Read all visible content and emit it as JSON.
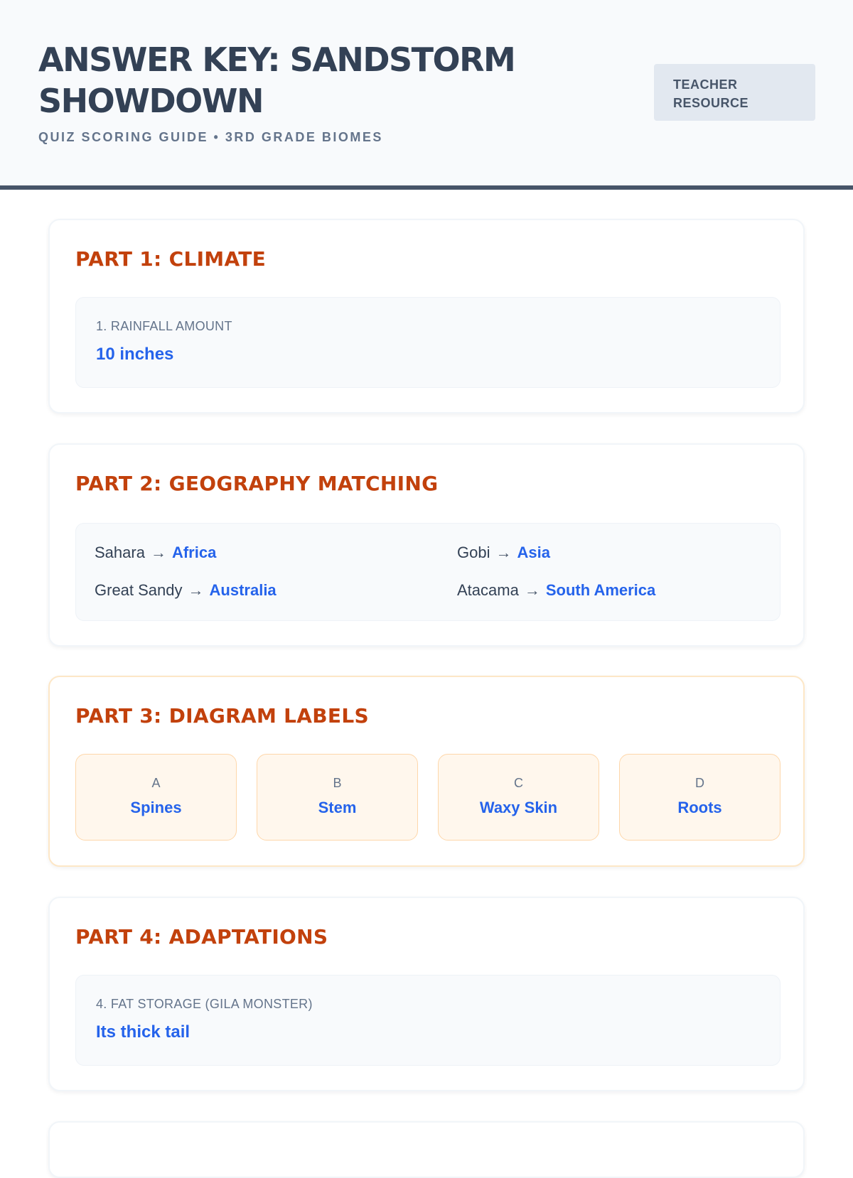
{
  "header": {
    "title": "ANSWER KEY: SANDSTORM SHOWDOWN",
    "subtitle": "QUIZ SCORING GUIDE • 3RD GRADE BIOMES",
    "badge": "TEACHER RESOURCE"
  },
  "part1": {
    "title": "PART 1: CLIMATE",
    "question": "1. RAINFALL AMOUNT",
    "answer": "10 inches"
  },
  "part2": {
    "title": "PART 2: GEOGRAPHY MATCHING",
    "arrow": "→",
    "matches": [
      {
        "desert": "Sahara",
        "answer": "Africa"
      },
      {
        "desert": "Gobi",
        "answer": "Asia"
      },
      {
        "desert": "Great Sandy",
        "answer": "Australia"
      },
      {
        "desert": "Atacama",
        "answer": "South America"
      }
    ]
  },
  "part3": {
    "title": "PART 3: DIAGRAM LABELS",
    "labels": [
      {
        "letter": "A",
        "text": "Spines"
      },
      {
        "letter": "B",
        "text": "Stem"
      },
      {
        "letter": "C",
        "text": "Waxy Skin"
      },
      {
        "letter": "D",
        "text": "Roots"
      }
    ]
  },
  "part4": {
    "title": "PART 4: ADAPTATIONS",
    "question": "4. FAT STORAGE (GILA MONSTER)",
    "answer": "Its thick tail"
  }
}
